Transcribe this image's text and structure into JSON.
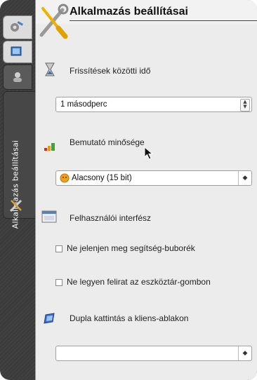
{
  "sidebar": {
    "vertical_label": "Alkalmazás beállításai"
  },
  "panel": {
    "title": "Alkalmazás beállításai",
    "refresh": {
      "label": "Frissítések közötti idő",
      "value": "1 másodperc"
    },
    "quality": {
      "label": "Bemutató minősége",
      "value": "Alacsony (15 bit)"
    },
    "ui": {
      "label": "Felhasználói interfész",
      "checkbox1": "Ne jelenjen meg segítség-buborék",
      "checkbox2": "Ne legyen felirat az eszköztár-gombon"
    },
    "doubleclick": {
      "label": "Dupla kattintás a kliens-ablakon",
      "value": ""
    }
  }
}
